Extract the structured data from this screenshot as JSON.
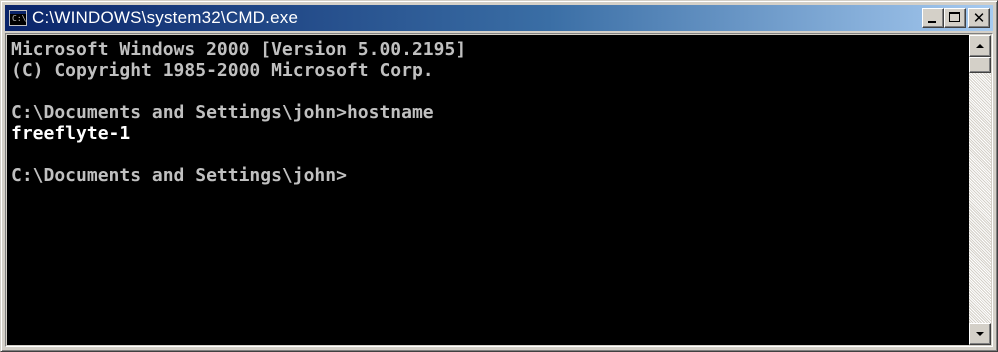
{
  "window": {
    "title": "C:\\WINDOWS\\system32\\CMD.exe",
    "icon": "cmd-icon",
    "icon_text": "C:\\",
    "buttons": {
      "minimize_icon": "minimize-icon",
      "maximize_icon": "maximize-icon",
      "close_icon": "close-icon",
      "close_label": "✕"
    }
  },
  "console": {
    "lines": [
      "Microsoft Windows 2000 [Version 5.00.2195]",
      "(C) Copyright 1985-2000 Microsoft Corp.",
      "",
      "C:\\Documents and Settings\\john>hostname",
      "freeflyte-1",
      "",
      "C:\\Documents and Settings\\john>"
    ],
    "colors": {
      "background": "#000000",
      "text": "#c0c0c0",
      "bright_text": "#ffffff"
    }
  },
  "scrollbar": {
    "up_icon": "scroll-up-arrow-icon",
    "down_icon": "scroll-down-arrow-icon",
    "position": 0
  },
  "theme": {
    "titlebar_start": "#0a246a",
    "titlebar_end": "#a6caf0",
    "face": "#d4d0c8"
  }
}
